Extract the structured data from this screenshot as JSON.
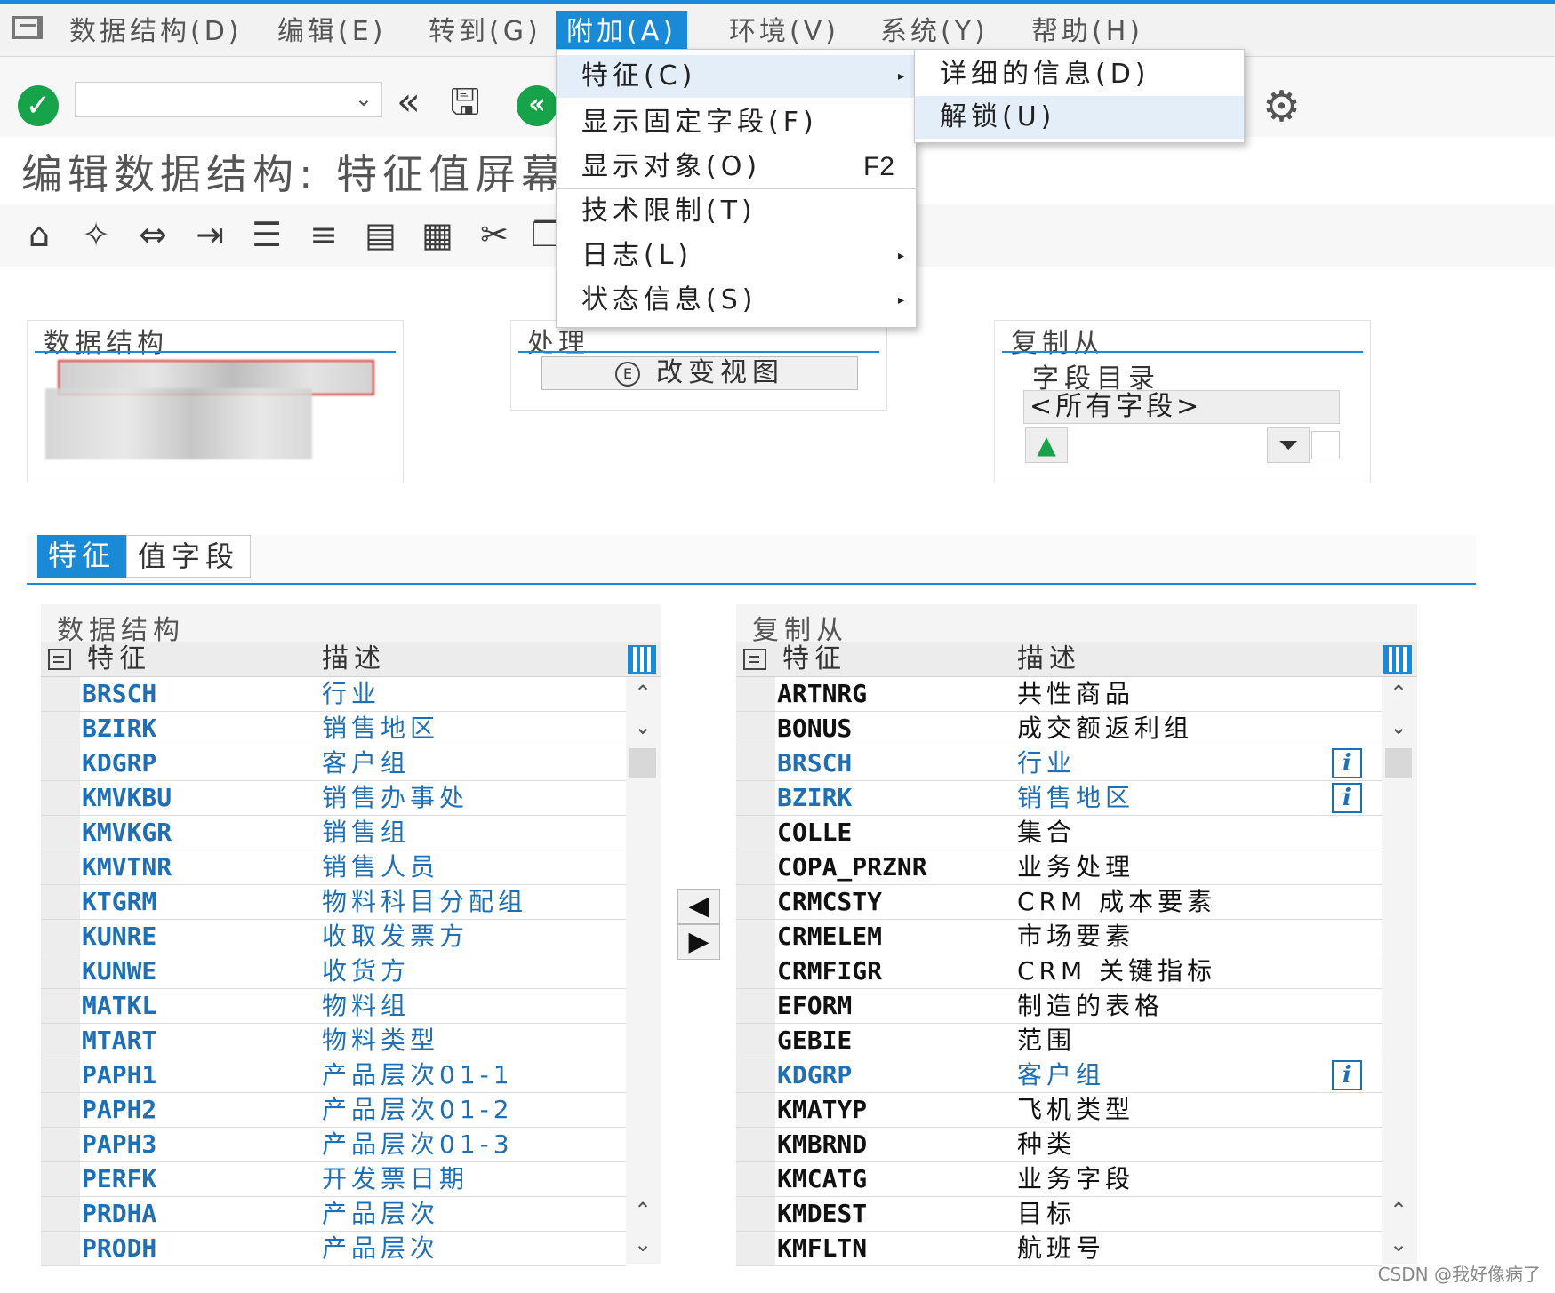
{
  "menubar": {
    "items": [
      {
        "label": "数据结构(D)"
      },
      {
        "label": "编辑(E)"
      },
      {
        "label": "转到(G)"
      },
      {
        "label": "附加(A)"
      },
      {
        "label": "环境(V)"
      },
      {
        "label": "系统(Y)"
      },
      {
        "label": "帮助(H)"
      }
    ]
  },
  "toolbar": {
    "command_field_value": ""
  },
  "title": "编辑数据结构: 特征值屏幕",
  "extras_menu": {
    "items": [
      {
        "label": "特征(C)",
        "accel": "",
        "submenu": true
      },
      {
        "label": "显示固定字段(F)",
        "accel": "",
        "submenu": false
      },
      {
        "label": "显示对象(O)",
        "accel": "F2",
        "submenu": false
      },
      {
        "label": "技术限制(T)",
        "accel": "",
        "submenu": false
      },
      {
        "label": "日志(L)",
        "accel": "",
        "submenu": true
      },
      {
        "label": "状态信息(S)",
        "accel": "",
        "submenu": true
      }
    ],
    "submenu": [
      {
        "label": "详细的信息(D)"
      },
      {
        "label": "解锁(U)"
      }
    ]
  },
  "groups": {
    "data_structure": {
      "title": "数据结构"
    },
    "processing": {
      "title": "处理",
      "button": "改变视图"
    },
    "copy_from": {
      "title": "复制从",
      "subtitle": "字段目录",
      "value": "<所有字段>"
    }
  },
  "tabs": [
    {
      "label": "特征"
    },
    {
      "label": "值字段"
    }
  ],
  "left_table": {
    "title": "数据结构",
    "col1": "特征",
    "col2": "描述",
    "rows": [
      {
        "key": "BRSCH",
        "desc": "行业"
      },
      {
        "key": "BZIRK",
        "desc": "销售地区"
      },
      {
        "key": "KDGRP",
        "desc": "客户组"
      },
      {
        "key": "KMVKBU",
        "desc": "销售办事处"
      },
      {
        "key": "KMVKGR",
        "desc": "销售组"
      },
      {
        "key": "KMVTNR",
        "desc": "销售人员"
      },
      {
        "key": "KTGRM",
        "desc": "物料科目分配组"
      },
      {
        "key": "KUNRE",
        "desc": "收取发票方"
      },
      {
        "key": "KUNWE",
        "desc": "收货方"
      },
      {
        "key": "MATKL",
        "desc": "物料组"
      },
      {
        "key": "MTART",
        "desc": "物料类型"
      },
      {
        "key": "PAPH1",
        "desc": "产品层次01-1"
      },
      {
        "key": "PAPH2",
        "desc": "产品层次01-2"
      },
      {
        "key": "PAPH3",
        "desc": "产品层次01-3"
      },
      {
        "key": "PERFK",
        "desc": "开发票日期"
      },
      {
        "key": "PRDHA",
        "desc": "产品层次"
      },
      {
        "key": "PRODH",
        "desc": "产品层次"
      }
    ]
  },
  "right_table": {
    "title": "复制从",
    "col1": "特征",
    "col2": "描述",
    "rows": [
      {
        "key": "ARTNRG",
        "desc": "共性商品",
        "used": false
      },
      {
        "key": "BONUS",
        "desc": "成交额返利组",
        "used": false
      },
      {
        "key": "BRSCH",
        "desc": "行业",
        "used": true
      },
      {
        "key": "BZIRK",
        "desc": "销售地区",
        "used": true
      },
      {
        "key": "COLLE",
        "desc": "集合",
        "used": false
      },
      {
        "key": "COPA_PRZNR",
        "desc": "业务处理",
        "used": false
      },
      {
        "key": "CRMCSTY",
        "desc": "CRM 成本要素",
        "used": false
      },
      {
        "key": "CRMELEM",
        "desc": "市场要素",
        "used": false
      },
      {
        "key": "CRMFIGR",
        "desc": "CRM 关键指标",
        "used": false
      },
      {
        "key": "EFORM",
        "desc": "制造的表格",
        "used": false
      },
      {
        "key": "GEBIE",
        "desc": "范围",
        "used": false
      },
      {
        "key": "KDGRP",
        "desc": "客户组",
        "used": true
      },
      {
        "key": "KMATYP",
        "desc": "飞机类型",
        "used": false
      },
      {
        "key": "KMBRND",
        "desc": "种类",
        "used": false
      },
      {
        "key": "KMCATG",
        "desc": "业务字段",
        "used": false
      },
      {
        "key": "KMDEST",
        "desc": "目标",
        "used": false
      },
      {
        "key": "KMFLTN",
        "desc": "航班号",
        "used": false
      }
    ]
  },
  "watermark": "CSDN @我好像病了",
  "colors": {
    "accent": "#1b8ad6",
    "link": "#1f6fb5",
    "ok": "#16a34a"
  }
}
